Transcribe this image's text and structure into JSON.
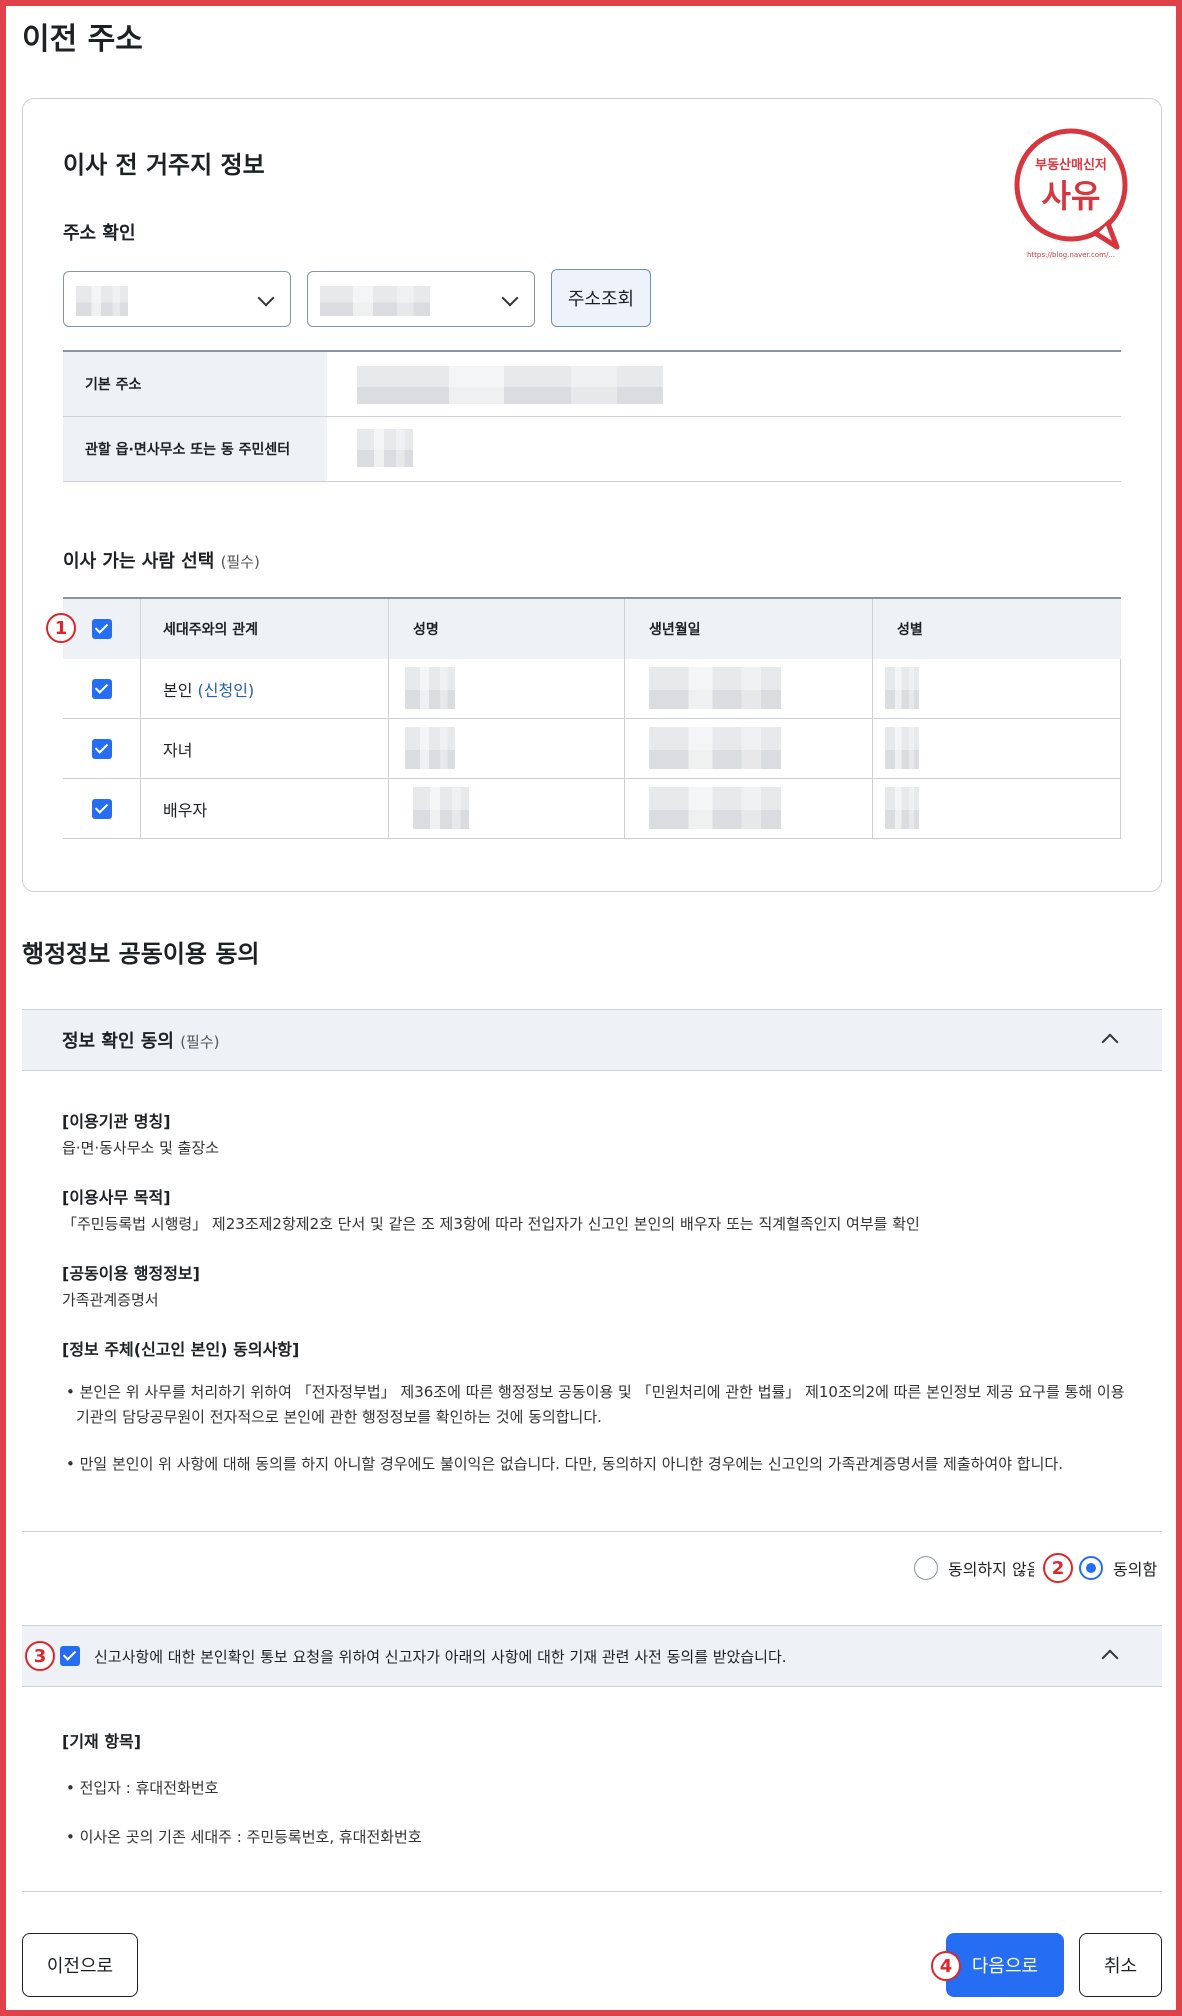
{
  "page": {
    "title": "이전 주소"
  },
  "card": {
    "title": "이사 전 거주지 정보",
    "address_section": {
      "title": "주소 확인",
      "lookup_button": "주소조회",
      "rows": [
        {
          "label": "기본 주소"
        },
        {
          "label": "관할 읍·면사무소 또는 동 주민센터"
        }
      ]
    },
    "logo": {
      "top_text": "부동산매신저",
      "main_text": "사유",
      "url": "https://blog.naver.com/..."
    },
    "people_section": {
      "title": "이사 가는 사람 선택",
      "required": "(필수)",
      "columns": [
        "세대주와의 관계",
        "성명",
        "생년월일",
        "성별"
      ],
      "rows": [
        {
          "relation": "본인",
          "note": "(신청인)",
          "checked": true
        },
        {
          "relation": "자녀",
          "note": "",
          "checked": true
        },
        {
          "relation": "배우자",
          "note": "",
          "checked": true
        }
      ]
    }
  },
  "consent": {
    "section_title": "행정정보 공동이용 동의",
    "accordion1": {
      "title": "정보 확인 동의",
      "required": "(필수)",
      "blocks": [
        {
          "head": "[이용기관 명칭]",
          "text": "읍·면·동사무소 및 출장소"
        },
        {
          "head": "[이용사무 목적]",
          "text": "「주민등록법 시행령」 제23조제2항제2호 단서 및 같은 조 제3항에 따라 전입자가 신고인 본인의 배우자 또는 직계혈족인지 여부를 확인"
        },
        {
          "head": "[공동이용 행정정보]",
          "text": "가족관계증명서"
        },
        {
          "head": "[정보 주체(신고인 본인) 동의사항]",
          "text": ""
        }
      ],
      "bullets": [
        "본인은 위 사무를 처리하기 위하여 「전자정부법」 제36조에 따른 행정정보 공동이용 및 「민원처리에 관한 법률」 제10조의2에 따른 본인정보 제공 요구를 통해 이용기관의 담당공무원이 전자적으로 본인에 관한 행정정보를 확인하는 것에 동의합니다.",
        "만일 본인이 위 사항에 대해 동의를 하지 아니할 경우에도 불이익은 없습니다. 다만, 동의하지 아니한 경우에는 신고인의 가족관계증명서를 제출하여야 합니다."
      ],
      "radio_disagree": "동의하지 않음",
      "radio_agree": "동의함",
      "selected": "agree"
    },
    "accordion2": {
      "title": "신고사항에 대한 본인확인 통보 요청을 위하여 신고자가 아래의 사항에 대한 기재 관련 사전 동의를 받았습니다.",
      "checked": true,
      "head": "[기재 항목]",
      "bullets": [
        "전입자 : 휴대전화번호",
        "이사온 곳의 기존 세대주 : 주민등록번호, 휴대전화번호"
      ]
    }
  },
  "footer": {
    "prev_button": "이전으로",
    "next_button": "다음으로",
    "cancel_button": "취소"
  },
  "annotations": [
    "1",
    "2",
    "3",
    "4"
  ],
  "colors": {
    "primary": "#256ef4",
    "annotation": "#e0242c",
    "frame": "#e0424a"
  }
}
